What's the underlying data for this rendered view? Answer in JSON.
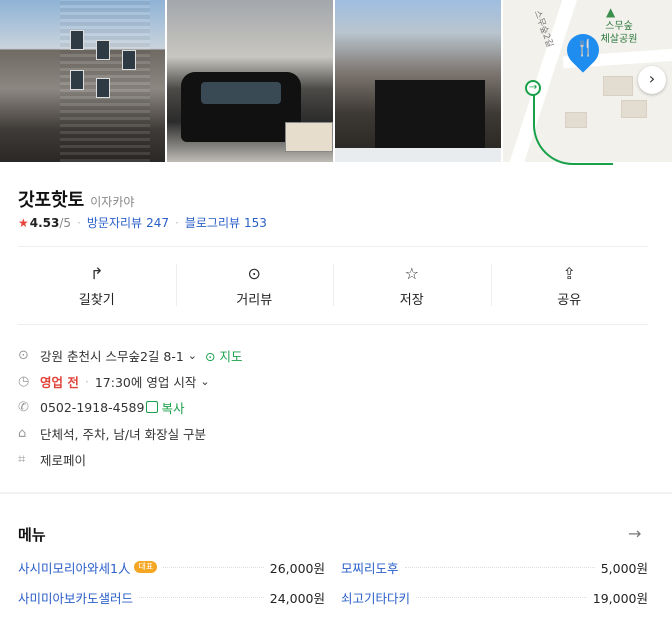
{
  "place": {
    "name": "갓포핫토",
    "category": "이자카야",
    "rating": "4.53",
    "rating_max": "/5",
    "visitor_review_label": "방문자리뷰",
    "visitor_review_count": "247",
    "blog_review_label": "블로그리뷰",
    "blog_review_count": "153"
  },
  "map": {
    "park_name": "스무숲\n체살공원",
    "street_label": "스무숲2길"
  },
  "actions": [
    {
      "label": "길찾기",
      "icon": "directions-icon"
    },
    {
      "label": "거리뷰",
      "icon": "location-pin-icon"
    },
    {
      "label": "저장",
      "icon": "star-icon"
    },
    {
      "label": "공유",
      "icon": "share-icon"
    }
  ],
  "info": {
    "address": "강원 춘천시 스무숲2길 8-1",
    "map_link": "지도",
    "status": "영업 전",
    "hours": "17:30에 영업 시작",
    "phone": "0502-1918-4589",
    "copy_label": "복사",
    "facilities": "단체석, 주차, 남/녀 화장실 구분",
    "payment": "제로페이"
  },
  "menu": {
    "title": "메뉴",
    "badge": "대표",
    "items": [
      {
        "name": "사시미모리아와세1人",
        "price": "26,000원",
        "badge": true
      },
      {
        "name": "모찌리도후",
        "price": "5,000원",
        "badge": false
      },
      {
        "name": "사미미아보카도샐러드",
        "price": "24,000원",
        "badge": false
      },
      {
        "name": "쇠고기타다키",
        "price": "19,000원",
        "badge": false
      }
    ]
  },
  "colors": {
    "accent_blue": "#2a5fc8",
    "accent_green": "#19a04a",
    "status_red": "#e0443a",
    "star_red": "#e8443a"
  }
}
